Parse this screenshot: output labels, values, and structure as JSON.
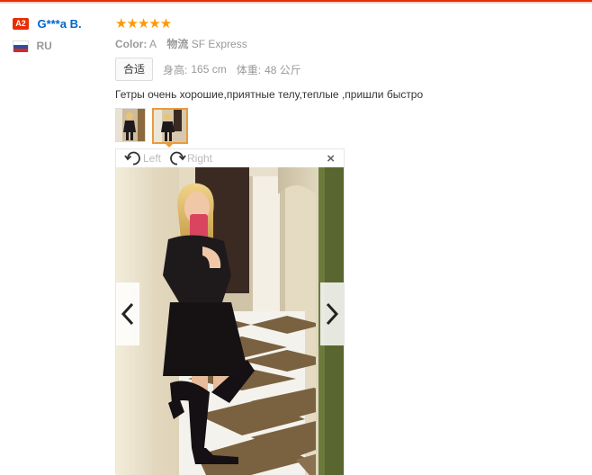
{
  "user": {
    "level_badge": "A2",
    "name": "G***a B.",
    "country": "RU"
  },
  "review": {
    "stars": "★★★★★",
    "rating": 5,
    "color_label": "Color:",
    "color_value": "A",
    "shipping_label": "物流",
    "shipping_value": "SF Express",
    "fit_tag": "合适",
    "height_label": "身高:",
    "height_value": "165 cm",
    "weight_label": "体重:",
    "weight_value": "48 公斤",
    "feedback_text": "Гетры очень хорошие,приятные телу,теплые ,пришли быстро"
  },
  "viewer": {
    "rotate_left_label": "Left",
    "rotate_right_label": "Right",
    "close_glyph": "×",
    "accent_color": "#e99b3a"
  },
  "icons": [
    "rotate-left-icon",
    "rotate-right-icon",
    "close-icon",
    "chevron-left-icon",
    "chevron-right-icon",
    "russia-flag-icon",
    "star-icon"
  ],
  "colors": {
    "brand_red": "#e62e04",
    "star": "#ff9900",
    "link_blue": "#0066cc"
  }
}
